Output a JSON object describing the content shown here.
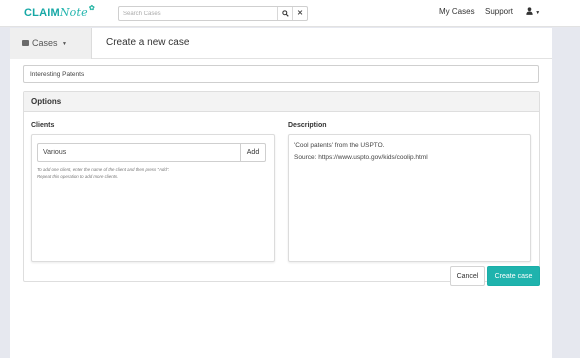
{
  "app": {
    "logo_main": "CLAIM",
    "logo_accent": "Note"
  },
  "navbar": {
    "search_placeholder": "Search Cases",
    "search_button_icon": "search-icon",
    "clear_button_icon": "close-icon",
    "links": [
      "My Cases",
      "Support"
    ],
    "user_icon": "user-icon",
    "user_caret": "chevron-down-icon"
  },
  "header": {
    "cases_label": "Cases",
    "title": "Create a new case"
  },
  "form": {
    "case_name_value": "Interesting Patents",
    "panel_title": "Options",
    "clients": {
      "label": "Clients",
      "input_value": "Various",
      "add_label": "Add",
      "help_lines": [
        "To add one client, enter the name of the client and then press \"Add\".",
        "Repeat this operation to add more clients."
      ]
    },
    "description": {
      "label": "Description",
      "lines": [
        "'Cool patents' from the USPTO.",
        "Source: https://www.uspto.gov/kids/coolip.html"
      ]
    },
    "cancel_label": "Cancel",
    "create_label": "Create case"
  },
  "colors": {
    "brand": "#1fb3ad",
    "background": "#e6e8ef"
  }
}
